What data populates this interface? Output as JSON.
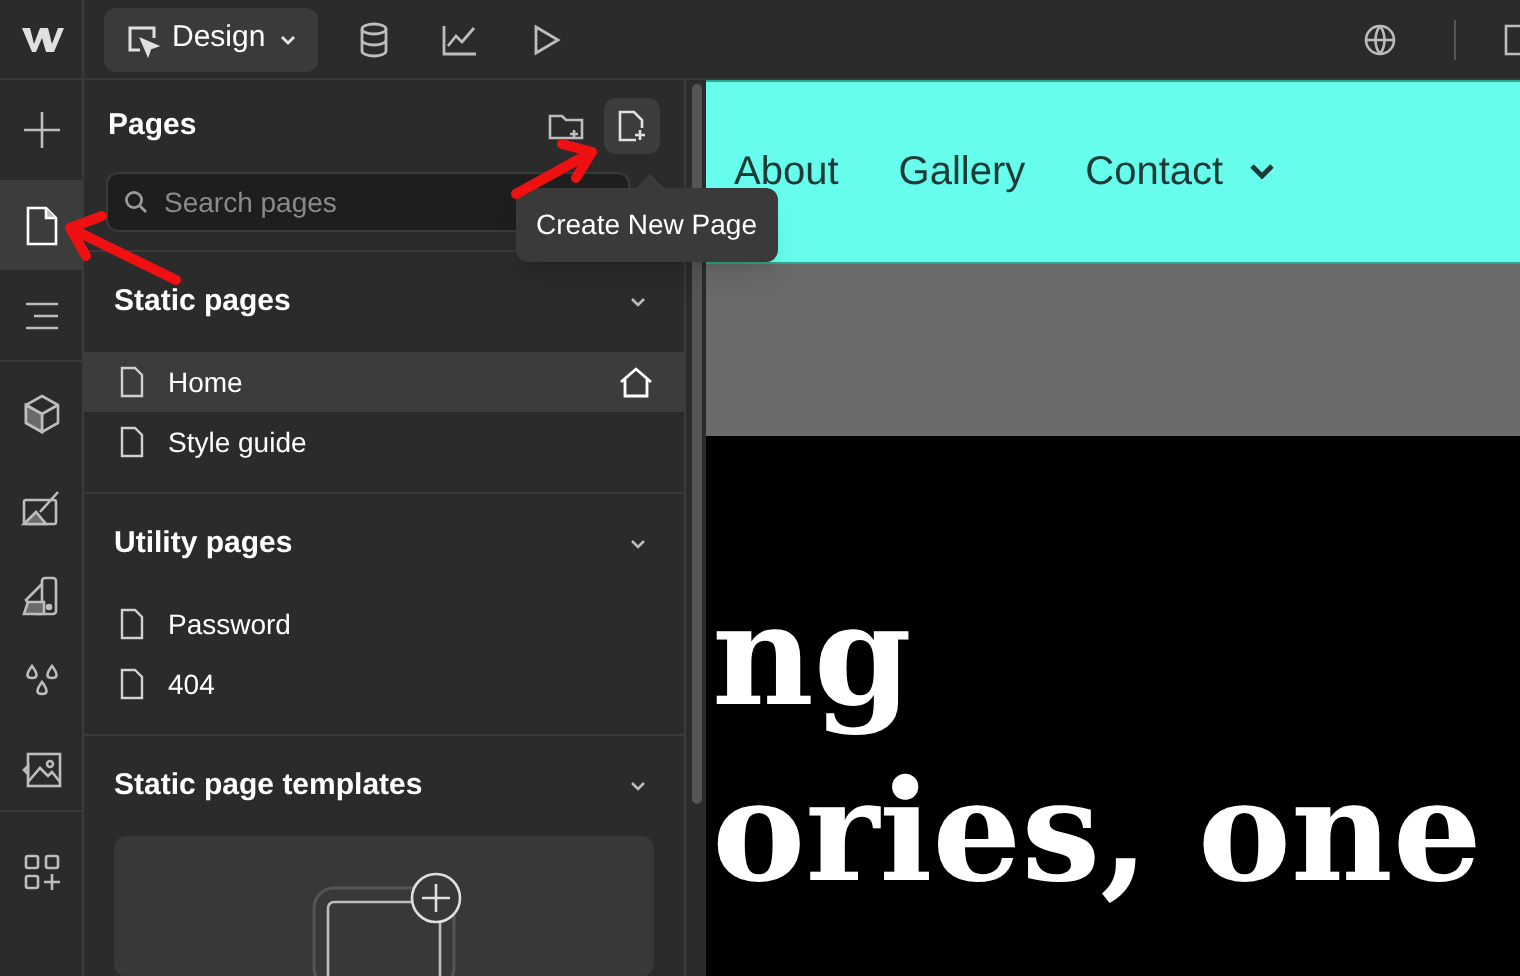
{
  "topbar": {
    "mode_button": {
      "label": "Design"
    },
    "tools": [
      {
        "kind": "database"
      },
      {
        "kind": "chart"
      },
      {
        "kind": "play"
      }
    ]
  },
  "rail": {
    "items": [
      {
        "kind": "add",
        "selected": false
      },
      {
        "kind": "pages",
        "selected": true
      },
      {
        "kind": "navigator",
        "selected": false
      },
      {
        "kind": "components",
        "selected": false
      },
      {
        "kind": "styles",
        "selected": false
      },
      {
        "kind": "swatches",
        "selected": false
      },
      {
        "kind": "variables",
        "selected": false
      },
      {
        "kind": "assets",
        "selected": false
      },
      {
        "kind": "apps",
        "selected": false
      }
    ]
  },
  "pages_panel": {
    "title": "Pages",
    "search": {
      "placeholder": "Search pages"
    },
    "tooltip": "Create New Page",
    "sections": [
      {
        "title": "Static pages",
        "expanded": true,
        "items": [
          {
            "label": "Home",
            "selected": true,
            "home": true
          },
          {
            "label": "Style guide",
            "selected": false,
            "home": false
          }
        ]
      },
      {
        "title": "Utility pages",
        "expanded": true,
        "items": [
          {
            "label": "Password",
            "selected": false,
            "home": false
          },
          {
            "label": "404",
            "selected": false,
            "home": false
          }
        ]
      },
      {
        "title": "Static page templates",
        "expanded": true
      }
    ]
  },
  "canvas": {
    "nav_links": [
      {
        "label": "About",
        "dropdown": false
      },
      {
        "label": "Gallery",
        "dropdown": false
      },
      {
        "label": "Contact",
        "dropdown": true
      }
    ],
    "heading_lines": [
      "ng",
      "ories, one"
    ]
  }
}
